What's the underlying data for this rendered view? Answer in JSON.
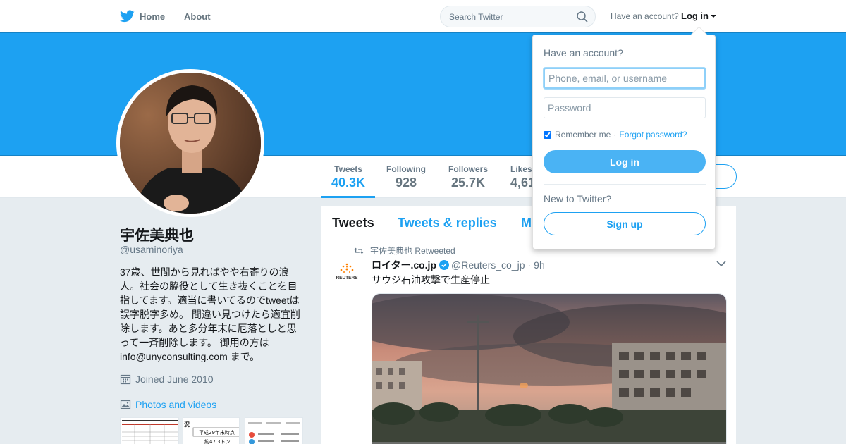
{
  "nav": {
    "home_label": "Home",
    "about_label": "About",
    "search_placeholder": "Search Twitter",
    "have_account": "Have an account?",
    "login_label": "Log in"
  },
  "profile": {
    "name": "宇佐美典也",
    "handle": "@usaminoriya",
    "bio": "37歳、世間から見ればやや右寄りの浪人。社会の脇役として生き抜くことを目指してます。適当に書いてるのでtweetは誤字脱字多め。 間違い見つけたら適宜削除します。あと多分年末に厄落としと思って一斉削除します。 御用の方は info@unyconsulting.com まで。",
    "joined": "Joined June 2010",
    "photos_label": "Photos and videos"
  },
  "stats": [
    {
      "label": "Tweets",
      "value": "40.3K"
    },
    {
      "label": "Following",
      "value": "928"
    },
    {
      "label": "Followers",
      "value": "25.7K"
    },
    {
      "label": "Likes",
      "value": "4,61"
    }
  ],
  "timeline": {
    "tabs": [
      "Tweets",
      "Tweets & replies",
      "M"
    ],
    "retweet_context": "宇佐美典也 Retweeted",
    "tweet": {
      "author": "ロイター.co.jp",
      "handle": "@Reuters_co_jp",
      "time": "9h",
      "text": "サウジ石油攻撃で生産停止",
      "avatar_text": "REUTERS"
    }
  },
  "thumbs": {
    "t2_heading": "況",
    "t2_row1": "平成29年末時点",
    "t2_row2": "約47 3トン"
  },
  "login": {
    "title": "Have an account?",
    "user_placeholder": "Phone, email, or username",
    "password_placeholder": "Password",
    "remember": "Remember me",
    "separator": "·",
    "forgot": "Forgot password?",
    "login_button": "Log in",
    "new_to": "New to Twitter?",
    "signup_button": "Sign up"
  },
  "colors": {
    "brand": "#1da1f2",
    "banner": "#1da1f2"
  }
}
